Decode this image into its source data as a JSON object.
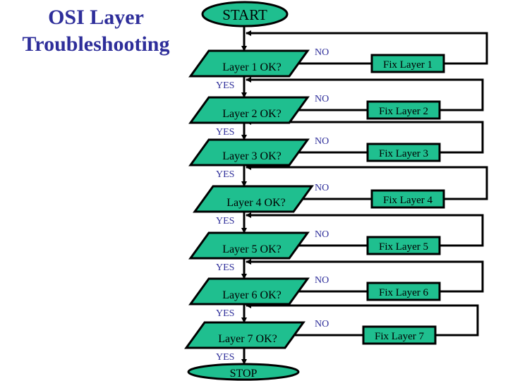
{
  "title": {
    "line1": "OSI Layer",
    "line2": "Troubleshooting"
  },
  "colors": {
    "shape_fill": "#1fbf8f",
    "stroke": "#000000",
    "label_color": "#2e2e9a",
    "text": "#000000"
  },
  "flowchart": {
    "start_label": "START",
    "stop_label": "STOP",
    "yes_label": "YES",
    "no_label": "NO",
    "steps": [
      {
        "question": "Layer 1 OK?",
        "fix": "Fix Layer 1"
      },
      {
        "question": "Layer 2 OK?",
        "fix": "Fix Layer 2"
      },
      {
        "question": "Layer 3 OK?",
        "fix": "Fix Layer 3"
      },
      {
        "question": "Layer 4 OK?",
        "fix": "Fix Layer 4"
      },
      {
        "question": "Layer 5 OK?",
        "fix": "Fix Layer 5"
      },
      {
        "question": "Layer 6 OK?",
        "fix": "Fix Layer 6"
      },
      {
        "question": "Layer 7 OK?",
        "fix": "Fix Layer 7"
      }
    ]
  }
}
